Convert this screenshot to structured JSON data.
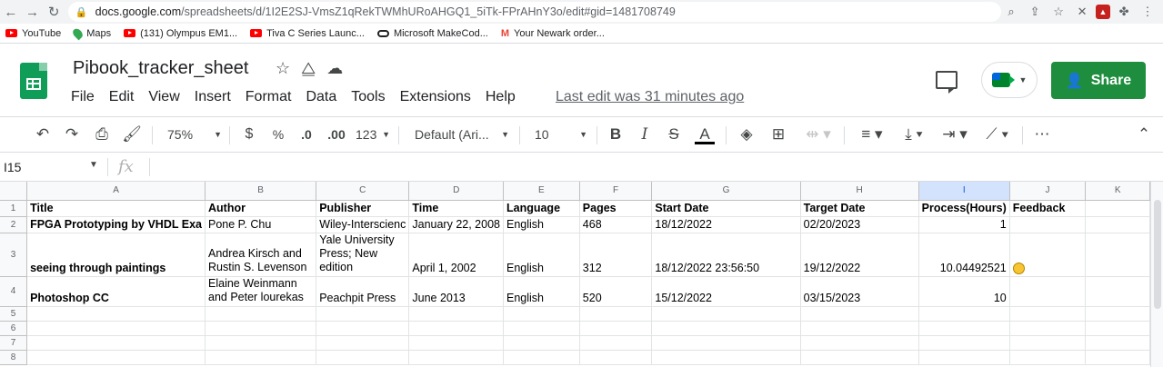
{
  "browser": {
    "url_host": "docs.google.com",
    "url_path": "/spreadsheets/d/1I2E2SJ-VmsZ1qRekTWMhURoAHGQ1_5iTk-FPrAHnY3o/edit#gid=1481708749",
    "bookmarks": [
      "YouTube",
      "Maps",
      "(131) Olympus EM1...",
      "Tiva C Series Launc...",
      "Microsoft MakeCod...",
      "Your Newark order..."
    ]
  },
  "header": {
    "title": "Pibook_tracker_sheet",
    "menu": [
      "File",
      "Edit",
      "View",
      "Insert",
      "Format",
      "Data",
      "Tools",
      "Extensions",
      "Help"
    ],
    "last_edit": "Last edit was 31 minutes ago",
    "share_label": "Share"
  },
  "toolbar": {
    "zoom": "75%",
    "currency": "$",
    "percent": "%",
    "dec_decrease": ".0",
    "dec_increase": ".00",
    "more_formats": "123",
    "font": "Default (Ari...",
    "font_size": "10",
    "bold": "B",
    "italic": "I",
    "strike": "S",
    "text_color": "A"
  },
  "formula_bar": {
    "name_box": "I15",
    "fx": "fx"
  },
  "sheet": {
    "columns": [
      "A",
      "B",
      "C",
      "D",
      "E",
      "F",
      "G",
      "H",
      "I",
      "J",
      "K"
    ],
    "rows": [
      {
        "num": "1",
        "cells": [
          "Title",
          "Author",
          "Publisher",
          "Time",
          "Language",
          "Pages",
          "Start Date",
          "Target Date",
          "Process(Hours)",
          "Feedback",
          ""
        ]
      },
      {
        "num": "2",
        "cells": [
          "FPGA Prototyping by VHDL Exa",
          "Pone P. Chu",
          "Wiley-Interscienc",
          "January 22, 2008",
          "English",
          "468",
          "18/12/2022",
          "02/20/2023",
          "1",
          "",
          ""
        ]
      },
      {
        "num": "3",
        "cells": [
          "seeing through paintings",
          "Andrea Kirsch and Rustin S. Levenson",
          "Yale University Press; New edition",
          "April 1, 2002",
          "English",
          "312",
          "18/12/2022 23:56:50",
          "19/12/2022",
          "10.04492521",
          "",
          ""
        ]
      },
      {
        "num": "4",
        "cells": [
          "Photoshop CC",
          "Elaine Weinmann and Peter lourekas",
          "Peachpit Press",
          "June 2013",
          "English",
          "520",
          "15/12/2022",
          "03/15/2023",
          "10",
          "",
          ""
        ]
      },
      {
        "num": "5",
        "cells": [
          "",
          "",
          "",
          "",
          "",
          "",
          "",
          "",
          "",
          "",
          ""
        ]
      },
      {
        "num": "6",
        "cells": [
          "",
          "",
          "",
          "",
          "",
          "",
          "",
          "",
          "",
          "",
          ""
        ]
      },
      {
        "num": "7",
        "cells": [
          "",
          "",
          "",
          "",
          "",
          "",
          "",
          "",
          "",
          "",
          ""
        ]
      },
      {
        "num": "8",
        "cells": [
          "",
          "",
          "",
          "",
          "",
          "",
          "",
          "",
          "",
          "",
          ""
        ]
      }
    ]
  },
  "colors": {
    "share_button": "#1e8e3e",
    "sheets_logo": "#0f9d58",
    "header_bg": "#f8f9fa",
    "selected_col": "#d3e3fd"
  }
}
